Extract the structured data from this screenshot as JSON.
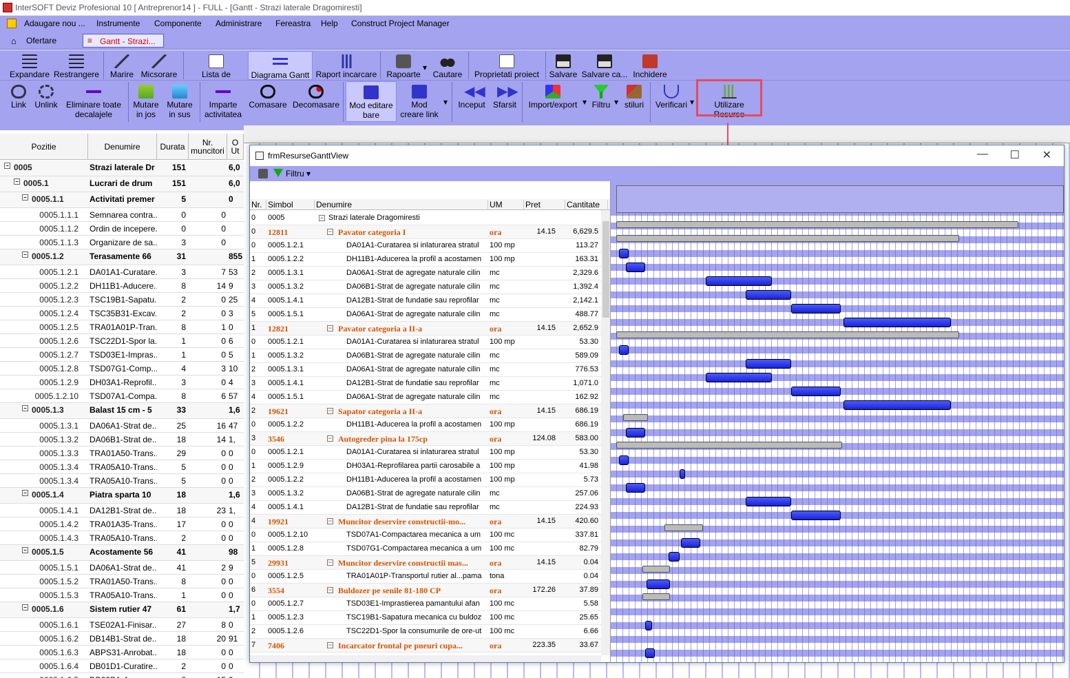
{
  "window": {
    "title": "InterSOFT Deviz Profesional 10 [ Antreprenor14 ] - FULL - [Gantt - Strazi laterale Dragomiresti]"
  },
  "menu": [
    "Adaugare nou ...",
    "Instrumente",
    "Componente",
    "Administrare",
    "Fereastra",
    "Help",
    "Construct Project Manager"
  ],
  "tabs": [
    {
      "label": "Ofertare"
    },
    {
      "label": "Gantt - Strazi..."
    }
  ],
  "toolbar1": [
    "Expandare",
    "Restrangere",
    "Marire",
    "Micsorare",
    "Lista de resurse",
    "Diagrama Gantt",
    "Raport incarcare",
    "Rapoarte",
    "Cautare",
    "Proprietati proiect",
    "Salvare",
    "Salvare ca...",
    "Inchidere"
  ],
  "toolbar2": [
    "Link",
    "Unlink",
    "Eliminare toate decalajele",
    "Mutare in jos",
    "Mutare in sus",
    "Imparte activitatea",
    "Comasare",
    "Decomasare",
    "Mod editare bare",
    "Mod creare link",
    "Inceput",
    "Sfarsit",
    "Import/export",
    "Filtru",
    "stiluri",
    "Verificari",
    "Utilizare Resurse"
  ],
  "left_grid": {
    "headers": [
      "Pozitie",
      "Denumire",
      "Durata",
      "Nr. muncitori",
      "O Ut"
    ],
    "rows": [
      {
        "pos": "0005",
        "den": "Strazi laterale Dr",
        "dur": "151",
        "mun": "",
        "ut": "6,0",
        "grp": true
      },
      {
        "pos": "0005.1",
        "den": "Lucrari de drum",
        "dur": "151",
        "mun": "",
        "ut": "6,0",
        "grp": true
      },
      {
        "pos": "0005.1.1",
        "den": "Activitati premer",
        "dur": "5",
        "mun": "",
        "ut": "0",
        "grp": true
      },
      {
        "pos": "0005.1.1.1",
        "den": "Semnarea contra...",
        "dur": "0",
        "mun": "0",
        "ut": ""
      },
      {
        "pos": "0005.1.1.2",
        "den": "Ordin de incepere...",
        "dur": "0",
        "mun": "0",
        "ut": ""
      },
      {
        "pos": "0005.1.1.3",
        "den": "Organizare de sa...",
        "dur": "3",
        "mun": "0",
        "ut": ""
      },
      {
        "pos": "0005.1.2",
        "den": "Terasamente 66",
        "dur": "31",
        "mun": "",
        "ut": "855",
        "grp": true
      },
      {
        "pos": "0005.1.2.1",
        "den": "DA01A1-Curatare...",
        "dur": "3",
        "mun": "7",
        "ut": "53"
      },
      {
        "pos": "0005.1.2.2",
        "den": "DH11B1-Aducere...",
        "dur": "8",
        "mun": "14",
        "ut": "9"
      },
      {
        "pos": "0005.1.2.3",
        "den": "TSC19B1-Sapatu...",
        "dur": "2",
        "mun": "0",
        "ut": "25"
      },
      {
        "pos": "0005.1.2.4",
        "den": "TSC35B31-Excav...",
        "dur": "2",
        "mun": "0",
        "ut": "3"
      },
      {
        "pos": "0005.1.2.5",
        "den": "TRA01A01P-Tran...",
        "dur": "8",
        "mun": "1",
        "ut": "0"
      },
      {
        "pos": "0005.1.2.6",
        "den": "TSC22D1-Spor la...",
        "dur": "1",
        "mun": "0",
        "ut": "6"
      },
      {
        "pos": "0005.1.2.7",
        "den": "TSD03E1-Impras...",
        "dur": "1",
        "mun": "0",
        "ut": "5"
      },
      {
        "pos": "0005.1.2.8",
        "den": "TSD07G1-Comp...",
        "dur": "4",
        "mun": "3",
        "ut": "10"
      },
      {
        "pos": "0005.1.2.9",
        "den": "DH03A1-Reprofil...",
        "dur": "3",
        "mun": "0",
        "ut": "4"
      },
      {
        "pos": "0005.1.2.10",
        "den": "TSD07A1-Compa...",
        "dur": "8",
        "mun": "6",
        "ut": "57"
      },
      {
        "pos": "0005.1.3",
        "den": "Balast 15 cm - 5",
        "dur": "33",
        "mun": "",
        "ut": "1,6",
        "grp": true
      },
      {
        "pos": "0005.1.3.1",
        "den": "DA06A1-Strat de...",
        "dur": "25",
        "mun": "16",
        "ut": "47"
      },
      {
        "pos": "0005.1.3.2",
        "den": "DA06B1-Strat de...",
        "dur": "18",
        "mun": "14",
        "ut": "1,"
      },
      {
        "pos": "0005.1.3.3",
        "den": "TRA01A50-Trans...",
        "dur": "29",
        "mun": "0",
        "ut": "0"
      },
      {
        "pos": "0005.1.3.4",
        "den": "TRA05A10-Trans...",
        "dur": "5",
        "mun": "0",
        "ut": "0"
      },
      {
        "pos": "0005.1.3.4",
        "den": "TRA05A10-Trans...",
        "dur": "5",
        "mun": "0",
        "ut": "0"
      },
      {
        "pos": "0005.1.4",
        "den": "Piatra sparta 10",
        "dur": "18",
        "mun": "",
        "ut": "1,6",
        "grp": true
      },
      {
        "pos": "0005.1.4.1",
        "den": "DA12B1-Strat de...",
        "dur": "18",
        "mun": "23",
        "ut": "1,"
      },
      {
        "pos": "0005.1.4.2",
        "den": "TRA01A35-Trans...",
        "dur": "17",
        "mun": "0",
        "ut": "0"
      },
      {
        "pos": "0005.1.4.3",
        "den": "TRA05A10-Trans...",
        "dur": "2",
        "mun": "0",
        "ut": "0"
      },
      {
        "pos": "0005.1.5",
        "den": "Acostamente 56",
        "dur": "41",
        "mun": "",
        "ut": "98",
        "grp": true
      },
      {
        "pos": "0005.1.5.1",
        "den": "DA06A1-Strat de...",
        "dur": "41",
        "mun": "2",
        "ut": "9"
      },
      {
        "pos": "0005.1.5.2",
        "den": "TRA01A50-Trans...",
        "dur": "8",
        "mun": "0",
        "ut": "0"
      },
      {
        "pos": "0005.1.5.3",
        "den": "TRA05A10-Trans...",
        "dur": "1",
        "mun": "0",
        "ut": "0"
      },
      {
        "pos": "0005.1.6",
        "den": "Sistem rutier 47",
        "dur": "61",
        "mun": "",
        "ut": "1,7",
        "grp": true
      },
      {
        "pos": "0005.1.6.1",
        "den": "TSE02A1-Finisar...",
        "dur": "27",
        "mun": "8",
        "ut": "0"
      },
      {
        "pos": "0005.1.6.2",
        "den": "DB14B1-Strat de...",
        "dur": "18",
        "mun": "20",
        "ut": "91"
      },
      {
        "pos": "0005.1.6.3",
        "den": "ABPS31-Anrobat...",
        "dur": "18",
        "mun": "0",
        "ut": "0"
      },
      {
        "pos": "0005.1.6.4",
        "den": "DB01D1-Curatire...",
        "dur": "2",
        "mun": "0",
        "ut": "0"
      },
      {
        "pos": "0005.1.6.5",
        "den": "DB02D1-Amorsar...",
        "dur": "8",
        "mun": "15",
        "ut": "0"
      }
    ]
  },
  "dialog": {
    "title": "frmResurseGanttView",
    "filter": "Filtru",
    "headers": [
      "Nr.",
      "Simbol",
      "Denumire",
      "UM",
      "Pret",
      "Cantitate"
    ],
    "rows": [
      {
        "nr": "0",
        "sim": "0005",
        "den": "Strazi laterale Dragomiresti",
        "um": "",
        "pret": "",
        "cant": "",
        "t": "root"
      },
      {
        "nr": "0",
        "sim": "12811",
        "den": "Pavator categoria I",
        "um": "ora",
        "pret": "14.15",
        "cant": "6,629.5",
        "t": "res"
      },
      {
        "nr": "0",
        "sim": "0005.1.2.1",
        "den": "DA01A1-Curatarea si inlaturarea stratul",
        "um": "100 mp",
        "pret": "",
        "cant": "113.27"
      },
      {
        "nr": "1",
        "sim": "0005.1.2.2",
        "den": "DH11B1-Aducerea la profil a acostamen",
        "um": "100 mp",
        "pret": "",
        "cant": "163.31"
      },
      {
        "nr": "2",
        "sim": "0005.1.3.1",
        "den": "DA06A1-Strat de agregate naturale cilin",
        "um": "mc",
        "pret": "",
        "cant": "2,329.6"
      },
      {
        "nr": "3",
        "sim": "0005.1.3.2",
        "den": "DA06B1-Strat de agregate naturale cilin",
        "um": "mc",
        "pret": "",
        "cant": "1,392.4"
      },
      {
        "nr": "4",
        "sim": "0005.1.4.1",
        "den": "DA12B1-Strat de fundatie sau reprofilar",
        "um": "mc",
        "pret": "",
        "cant": "2,142.1"
      },
      {
        "nr": "5",
        "sim": "0005.1.5.1",
        "den": "DA06A1-Strat de agregate naturale cilin",
        "um": "mc",
        "pret": "",
        "cant": "488.77"
      },
      {
        "nr": "1",
        "sim": "12821",
        "den": "Pavator categoria a II-a",
        "um": "ora",
        "pret": "14.15",
        "cant": "2,652.9",
        "t": "res"
      },
      {
        "nr": "0",
        "sim": "0005.1.2.1",
        "den": "DA01A1-Curatarea si inlaturarea stratul",
        "um": "100 mp",
        "pret": "",
        "cant": "53.30"
      },
      {
        "nr": "1",
        "sim": "0005.1.3.2",
        "den": "DA06B1-Strat de agregate naturale cilin",
        "um": "mc",
        "pret": "",
        "cant": "589.09"
      },
      {
        "nr": "2",
        "sim": "0005.1.3.1",
        "den": "DA06A1-Strat de agregate naturale cilin",
        "um": "mc",
        "pret": "",
        "cant": "776.53"
      },
      {
        "nr": "3",
        "sim": "0005.1.4.1",
        "den": "DA12B1-Strat de fundatie sau reprofilar",
        "um": "mc",
        "pret": "",
        "cant": "1,071.0"
      },
      {
        "nr": "4",
        "sim": "0005.1.5.1",
        "den": "DA06A1-Strat de agregate naturale cilin",
        "um": "mc",
        "pret": "",
        "cant": "162.92"
      },
      {
        "nr": "2",
        "sim": "19621",
        "den": "Sapator categoria a II-a",
        "um": "ora",
        "pret": "14.15",
        "cant": "686.19",
        "t": "res"
      },
      {
        "nr": "0",
        "sim": "0005.1.2.2",
        "den": "DH11B1-Aducerea la profil a acostamen",
        "um": "100 mp",
        "pret": "",
        "cant": "686.19"
      },
      {
        "nr": "3",
        "sim": "3546",
        "den": "Autogreder pina la 175cp",
        "um": "ora",
        "pret": "124.08",
        "cant": "583.00",
        "t": "res"
      },
      {
        "nr": "0",
        "sim": "0005.1.2.1",
        "den": "DA01A1-Curatarea si inlaturarea stratul",
        "um": "100 mp",
        "pret": "",
        "cant": "53.30"
      },
      {
        "nr": "1",
        "sim": "0005.1.2.9",
        "den": "DH03A1-Reprofilarea partii carosabile a",
        "um": "100 mp",
        "pret": "",
        "cant": "41.98"
      },
      {
        "nr": "2",
        "sim": "0005.1.2.2",
        "den": "DH11B1-Aducerea la profil a acostamen",
        "um": "100 mp",
        "pret": "",
        "cant": "5.73"
      },
      {
        "nr": "3",
        "sim": "0005.1.3.2",
        "den": "DA06B1-Strat de agregate naturale cilin",
        "um": "mc",
        "pret": "",
        "cant": "257.06"
      },
      {
        "nr": "4",
        "sim": "0005.1.4.1",
        "den": "DA12B1-Strat de fundatie sau reprofilar",
        "um": "mc",
        "pret": "",
        "cant": "224.93"
      },
      {
        "nr": "4",
        "sim": "19921",
        "den": "Muncitor deservire constructii-mo...",
        "um": "ora",
        "pret": "14.15",
        "cant": "420.60",
        "t": "res"
      },
      {
        "nr": "0",
        "sim": "0005.1.2.10",
        "den": "TSD07A1-Compactarea mecanica a um",
        "um": "100 mc",
        "pret": "",
        "cant": "337.81"
      },
      {
        "nr": "1",
        "sim": "0005.1.2.8",
        "den": "TSD07G1-Compactarea mecanica a um",
        "um": "100 mc",
        "pret": "",
        "cant": "82.79"
      },
      {
        "nr": "5",
        "sim": "29931",
        "den": "Muncitor deservire constructii mas...",
        "um": "ora",
        "pret": "14.15",
        "cant": "0.04",
        "t": "res"
      },
      {
        "nr": "0",
        "sim": "0005.1.2.5",
        "den": "TRA01A01P-Transportul rutier al...pama",
        "um": "tona",
        "pret": "",
        "cant": "0.04"
      },
      {
        "nr": "6",
        "sim": "3554",
        "den": "Buldozer pe senile 81-180 CP",
        "um": "ora",
        "pret": "172.26",
        "cant": "37.89",
        "t": "res"
      },
      {
        "nr": "0",
        "sim": "0005.1.2.7",
        "den": "TSD03E1-Imprastierea pamantului afan",
        "um": "100 mc",
        "pret": "",
        "cant": "5.58"
      },
      {
        "nr": "1",
        "sim": "0005.1.2.3",
        "den": "TSC19B1-Sapatura mecanica cu buldoz",
        "um": "100 mc",
        "pret": "",
        "cant": "25.65"
      },
      {
        "nr": "2",
        "sim": "0005.1.2.6",
        "den": "TSC22D1-Spor la consumurile de ore-ut",
        "um": "100 mc",
        "pret": "",
        "cant": "6.66"
      },
      {
        "nr": "7",
        "sim": "7406",
        "den": "Incarcator frontal pe pneuri cupa...",
        "um": "ora",
        "pret": "223.35",
        "cant": "33.67",
        "t": "res"
      }
    ]
  }
}
